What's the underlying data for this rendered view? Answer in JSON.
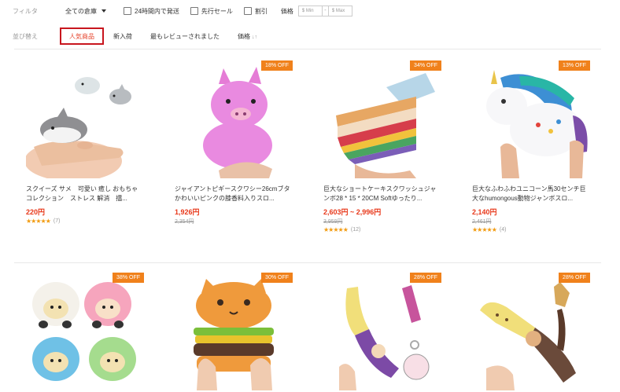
{
  "filter": {
    "label": "フィルタ",
    "warehouse": "全ての倉庫",
    "checkboxes": [
      "24時間内で発送",
      "先行セール",
      "割引"
    ],
    "price_label": "価格",
    "min_placeholder": "$ Min",
    "max_placeholder": "$ Max",
    "dash": "-"
  },
  "sort": {
    "label": "並び替え",
    "items": [
      "人気商品",
      "新入荷",
      "最もレビューされました",
      "価格"
    ],
    "price_arrow": "↓↑"
  },
  "products": [
    {
      "title": "スクイーズ サメ　可愛い 癒し おもちゃ コレクション　ストレス 解消　擂...",
      "price": "220円",
      "old_price": "",
      "discount": "",
      "stars": "★★★★★",
      "reviews": "(7)",
      "icon": "shark-squishy-image"
    },
    {
      "title": "ジャイアントピギースクワシー26cmブタかわいいピンクの膝香料入りスロ...",
      "price": "1,926円",
      "old_price": "2,354円",
      "discount": "18% OFF",
      "stars": "",
      "reviews": "",
      "icon": "pig-squishy-image"
    },
    {
      "title": "巨大なショートケーキスクワッシュジャンボ28 * 15 * 20CM Softゆったり...",
      "price": "2,603円 ~ 2,996円",
      "old_price": "3,959円",
      "discount": "34% OFF",
      "stars": "★★★★★",
      "reviews": "(12)",
      "icon": "cake-squishy-image"
    },
    {
      "title": "巨大なふわふわユニコーン馬30センチ巨大なhumongous動物ジャンボスロ...",
      "price": "2,140円",
      "old_price": "2,461円",
      "discount": "13% OFF",
      "stars": "★★★★★",
      "reviews": "(4)",
      "icon": "unicorn-squishy-image"
    },
    {
      "discount": "38% OFF",
      "icon": "sheep-squishy-image"
    },
    {
      "discount": "30% OFF",
      "icon": "burger-cat-squishy-image"
    },
    {
      "discount": "28% OFF",
      "icon": "banana-squishy-image"
    },
    {
      "discount": "28% OFF",
      "icon": "banana-monkey-squishy-image"
    }
  ]
}
